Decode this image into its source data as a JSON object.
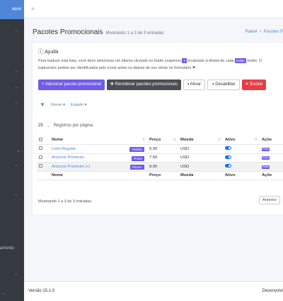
{
  "sidebar": {
    "top_text": "aque",
    "item_text": "amento",
    "bottom_text": "..."
  },
  "header": {
    "title": "Pacotes Promocionais",
    "subtitle": "Mostrando 1 a 3 de 3 entradas",
    "breadcrumb": [
      "Painel",
      "Pacotes P"
    ]
  },
  "help": {
    "title": "Ajuda",
    "text_part1": "Para traduzir esta lista, você deve selecionar um idioma clicando no botão suspenso",
    "text_part2": "localizado à direita de cada",
    "edit_chip": "Editar",
    "text_part3": "botão. O",
    "text_part4": "traduzíveis podem ser identificados pelo ícone antes ou depois de seu rótulo no formulário"
  },
  "toolbar": {
    "add": "Adicionar pacote promocional",
    "reorder": "Reordenar pacotes promocionais",
    "activate": "Ativar",
    "deactivate": "Desabilitar",
    "delete": "Excluir"
  },
  "filters": [
    "Nome",
    "Estado"
  ],
  "per_page": {
    "value": "25",
    "label": "Registros por página"
  },
  "table": {
    "headers": [
      "Nome",
      "Preço",
      "Moeda",
      "Ativo",
      "Açõe"
    ],
    "rows": [
      {
        "name": "Lista Regular",
        "badge": "Padrão",
        "price": "0.00",
        "currency": "USD",
        "edit": "Editar"
      },
      {
        "name": "Anúncio Premium",
        "badge": "Prime",
        "price": "7.50",
        "currency": "USD",
        "edit": "Editar"
      },
      {
        "name": "Anúncio Premium (+)",
        "badge": "Prime+",
        "price": "9.00",
        "currency": "USD",
        "edit": "Editar"
      }
    ]
  },
  "showing": "Mostrando 1 a 3 de 3 entradas.",
  "pager_prev": "Anterior",
  "footer": {
    "version": "Versão 15.1.0",
    "dev": "Desenvolvi"
  },
  "colors": {
    "accent": "#6f5ce8",
    "brand": "#4f86d6",
    "danger": "#e63e45",
    "sidebar": "#343a40"
  }
}
